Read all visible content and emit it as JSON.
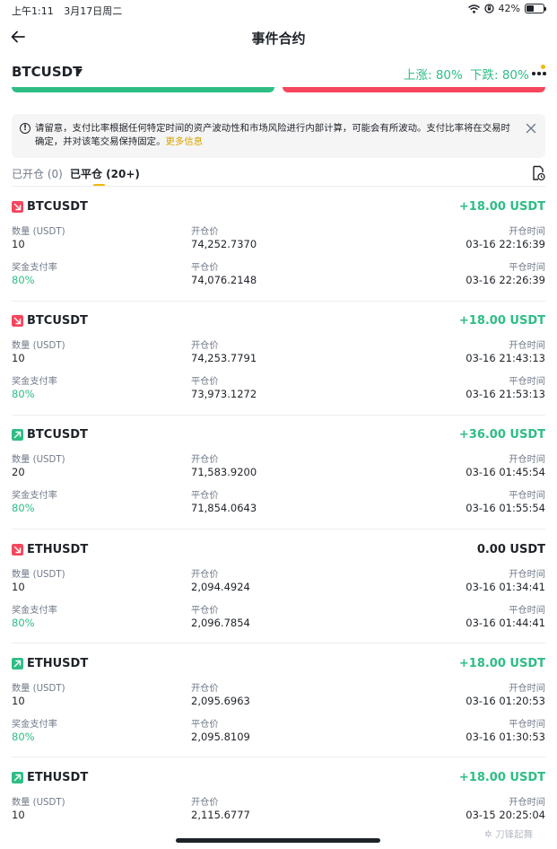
{
  "status_bar": {
    "time": "上午1:11",
    "date": "3月17日周二",
    "battery": "42%",
    "battery_level": 0.42
  },
  "nav": {
    "title": "事件合约"
  },
  "symbol": {
    "name": "BTCUSDT",
    "rise_label": "上涨: 80%",
    "fall_label": "下跌: 80%"
  },
  "notice": {
    "text": "请留意，支付比率根据任何特定时间的资产波动性和市场风险进行内部计算，可能会有所波动。支付比率将在交易时确定，并对该笔交易保持固定。",
    "link": "更多信息"
  },
  "tabs": {
    "open": "已开仓 (0)",
    "closed": "已平仓 (20+)"
  },
  "labels": {
    "quantity": "数量 (USDT)",
    "open_price": "开仓价",
    "open_time": "开仓时间",
    "payout": "奖金支付率",
    "close_price": "平仓价",
    "close_time": "平仓时间"
  },
  "colors": {
    "green": "#2ebd85",
    "red": "#f6465d",
    "yellow": "#f0b90b"
  },
  "records": [
    {
      "symbol": "BTCUSDT",
      "direction": "down",
      "pnl": "+18.00 USDT",
      "quantity": "10",
      "open_price": "74,252.7370",
      "open_time": "03-16 22:16:39",
      "payout": "80%",
      "close_price": "74,076.2148",
      "close_time": "03-16 22:26:39"
    },
    {
      "symbol": "BTCUSDT",
      "direction": "down",
      "pnl": "+18.00 USDT",
      "quantity": "10",
      "open_price": "74,253.7791",
      "open_time": "03-16 21:43:13",
      "payout": "80%",
      "close_price": "73,973.1272",
      "close_time": "03-16 21:53:13"
    },
    {
      "symbol": "BTCUSDT",
      "direction": "up",
      "pnl": "+36.00 USDT",
      "quantity": "20",
      "open_price": "71,583.9200",
      "open_time": "03-16 01:45:54",
      "payout": "80%",
      "close_price": "71,854.0643",
      "close_time": "03-16 01:55:54"
    },
    {
      "symbol": "ETHUSDT",
      "direction": "down",
      "pnl": "0.00 USDT",
      "quantity": "10",
      "open_price": "2,094.4924",
      "open_time": "03-16 01:34:41",
      "payout": "80%",
      "close_price": "2,096.7854",
      "close_time": "03-16 01:44:41"
    },
    {
      "symbol": "ETHUSDT",
      "direction": "up",
      "pnl": "+18.00 USDT",
      "quantity": "10",
      "open_price": "2,095.6963",
      "open_time": "03-16 01:20:53",
      "payout": "80%",
      "close_price": "2,095.8109",
      "close_time": "03-16 01:30:53"
    },
    {
      "symbol": "ETHUSDT",
      "direction": "up",
      "pnl": "+18.00 USDT",
      "quantity": "10",
      "open_price": "2,115.6777",
      "open_time": "03-15 20:25:04"
    }
  ],
  "watermark": "刀锋起舞"
}
